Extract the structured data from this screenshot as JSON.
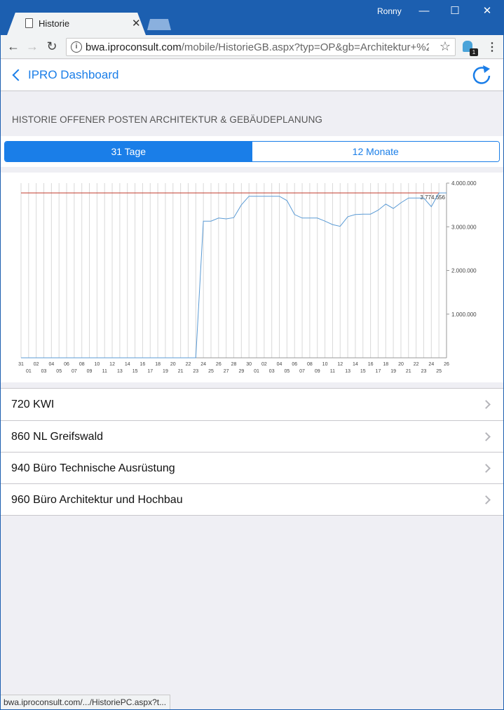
{
  "browser": {
    "tab_title": "Historie",
    "user_name": "Ronny",
    "url_host": "bwa.iproconsult.com",
    "url_path": "/mobile/HistorieGB.aspx?typ=OP&gb=Architektur+%26+...",
    "extension_badge": "1",
    "status_url": "bwa.iproconsult.com/.../HistoriePC.aspx?t..."
  },
  "navbar": {
    "back_label": "IPRO Dashboard"
  },
  "section": {
    "title": "HISTORIE OFFENER POSTEN ARCHITEKTUR & GEBÄUDEPLANUNG"
  },
  "segments": {
    "days": "31 Tage",
    "months": "12 Monate",
    "active": "days"
  },
  "colors": {
    "accent": "#1a7ee8",
    "reference_line": "#c0392b",
    "series_line": "#5b9bd5",
    "titlebar": "#1c5fb0"
  },
  "chart_data": {
    "type": "line",
    "x": [
      "31",
      "01",
      "02",
      "03",
      "04",
      "05",
      "06",
      "07",
      "08",
      "09",
      "10",
      "11",
      "12",
      "13",
      "14",
      "15",
      "16",
      "17",
      "18",
      "19",
      "20",
      "21",
      "22",
      "23",
      "24",
      "25",
      "26",
      "27",
      "28",
      "29",
      "30",
      "01",
      "02",
      "03",
      "04",
      "05",
      "06",
      "07",
      "08",
      "09",
      "10",
      "11",
      "12",
      "13",
      "14",
      "15",
      "16",
      "17",
      "18",
      "19",
      "20",
      "21",
      "22",
      "23",
      "24",
      "25",
      "26"
    ],
    "series": [
      {
        "values": [
          0,
          0,
          0,
          0,
          0,
          0,
          0,
          0,
          0,
          0,
          0,
          0,
          0,
          0,
          0,
          0,
          0,
          0,
          0,
          0,
          0,
          0,
          0,
          0,
          3130000,
          3130000,
          3200000,
          3180000,
          3210000,
          3500000,
          3700000,
          3700000,
          3700000,
          3700000,
          3700000,
          3600000,
          3280000,
          3200000,
          3200000,
          3200000,
          3130000,
          3050000,
          3010000,
          3230000,
          3280000,
          3290000,
          3290000,
          3380000,
          3520000,
          3420000,
          3550000,
          3660000,
          3660000,
          3660000,
          3460000,
          3774656,
          3774656
        ]
      }
    ],
    "reference_value": 3774656,
    "reference_label": "3.774.656",
    "y_ticks": [
      "4.000.000",
      "3.000.000",
      "2.000.000",
      "1.000.000"
    ],
    "ylim": [
      0,
      4000000
    ],
    "grid": true
  },
  "list": {
    "items": [
      {
        "label": "720 KWI"
      },
      {
        "label": "860 NL Greifswald"
      },
      {
        "label": "940 Büro Technische Ausrüstung"
      },
      {
        "label": "960 Büro Architektur und Hochbau"
      }
    ]
  }
}
